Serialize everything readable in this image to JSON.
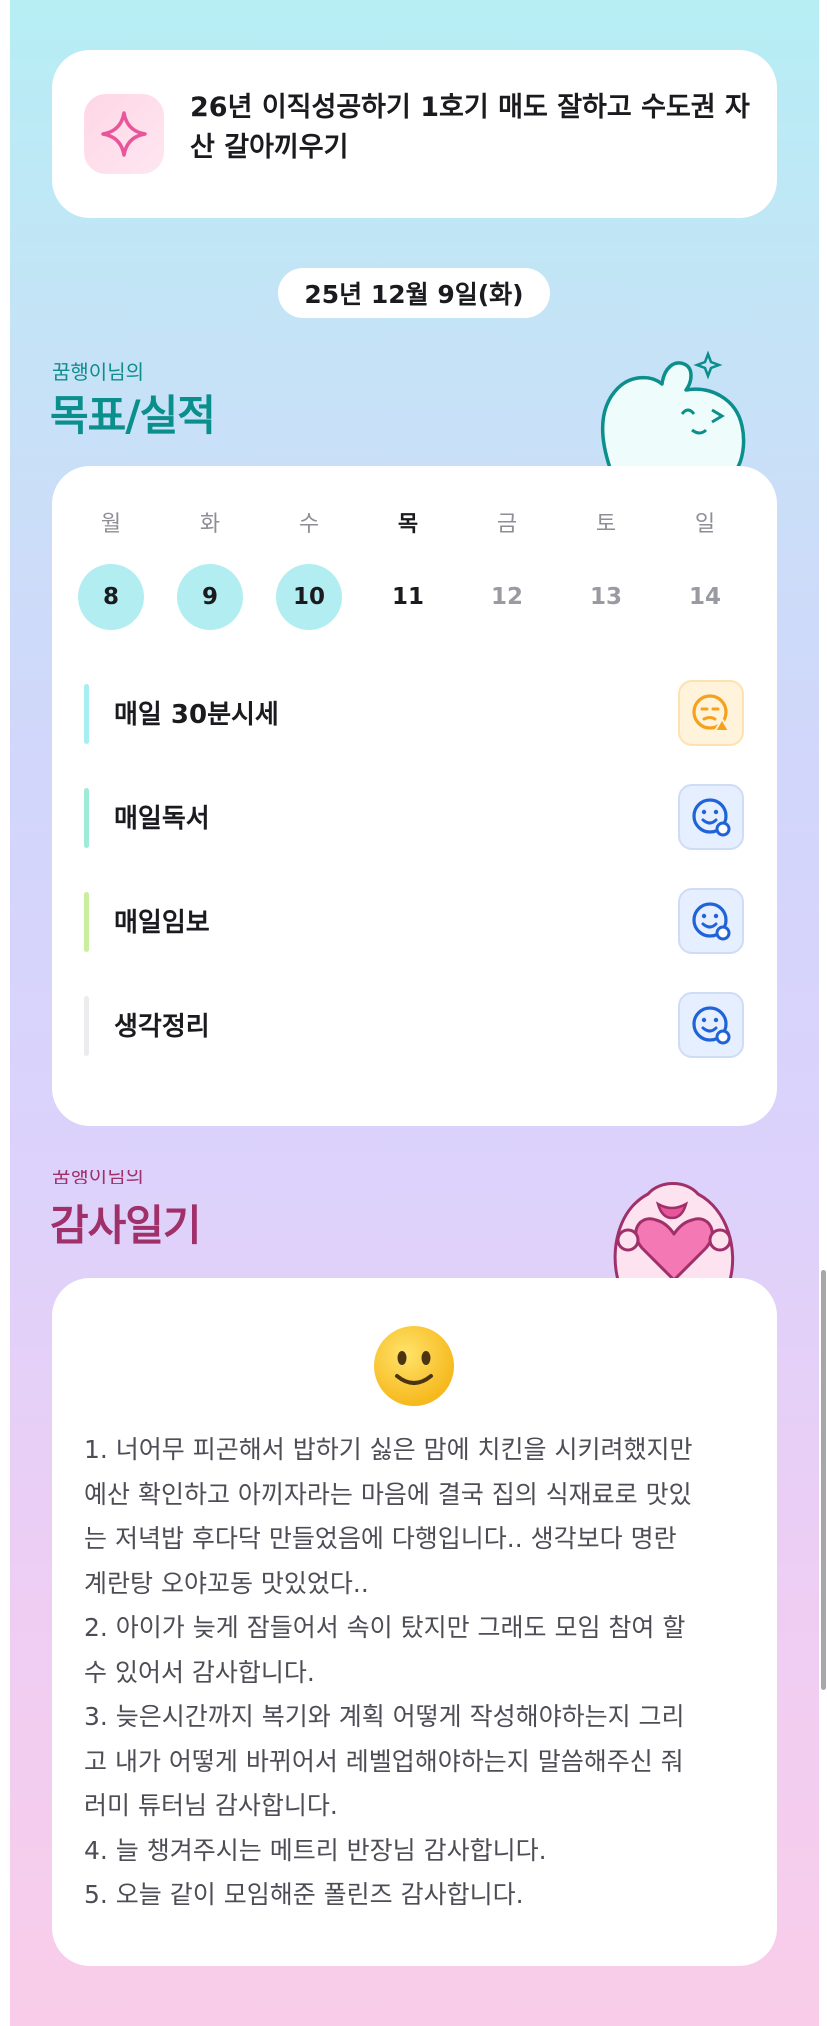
{
  "goal_banner": {
    "icon": "sparkle-icon",
    "text": "26년 이직성공하기 1호기 매도 잘하고 수도권 자산 갈아끼우기"
  },
  "date_chip": "25년 12월 9일(화)",
  "goals_section": {
    "subtitle": "꿈행이님의",
    "title": "목표/실적",
    "title_color": "#0b8f8c"
  },
  "week": {
    "days": [
      {
        "label": "월",
        "num": "8",
        "state": "done"
      },
      {
        "label": "화",
        "num": "9",
        "state": "done"
      },
      {
        "label": "수",
        "num": "10",
        "state": "done"
      },
      {
        "label": "목",
        "num": "11",
        "state": "today"
      },
      {
        "label": "금",
        "num": "12",
        "state": "future"
      },
      {
        "label": "토",
        "num": "13",
        "state": "future"
      },
      {
        "label": "일",
        "num": "14",
        "state": "future"
      }
    ],
    "done_color": "#b2eef1"
  },
  "goals": [
    {
      "label": "매일 30분시세",
      "bar_color": "#a7eef0",
      "status_icon": "face-warning-icon",
      "status_color": "#f5a11c"
    },
    {
      "label": "매일독서",
      "bar_color": "#9eebd8",
      "status_icon": "face-smile-check-icon",
      "status_color": "#1f63d6"
    },
    {
      "label": "매일임보",
      "bar_color": "#c9ee9e",
      "status_icon": "face-smile-check-icon",
      "status_color": "#1f63d6"
    },
    {
      "label": "생각정리",
      "bar_color": "#ececef",
      "status_icon": "face-smile-check-icon",
      "status_color": "#1f63d6"
    }
  ],
  "gratitude_section": {
    "title": "감사일기",
    "title_color": "#a0306a"
  },
  "diary": {
    "mood_icon": "slightly-smiling-face-icon",
    "text": "1. 너어무 피곤해서 밥하기 싫은 맘에 치킨을 시키려했지만\n예산 확인하고 아끼자라는 마음에 결국 집의 식재료로 맛있\n는 저녁밥 후다닥 만들었음에 다행입니다.. 생각보다 명란\n계란탕 오야꼬동 맛있었다..\n2. 아이가 늦게 잠들어서 속이 탔지만 그래도 모임 참여 할\n수 있어서 감사합니다.\n3. 늦은시간까지 복기와 계획 어떻게 작성해야하는지 그리\n고 내가 어떻게 바뀌어서 레벨업해야하는지 말씀해주신 줘\n러미 튜터님 감사합니다.\n4. 늘 챙겨주시는 메트리 반장님 감사합니다.\n5. 오늘 같이 모임해준 폴린즈 감사합니다."
  }
}
